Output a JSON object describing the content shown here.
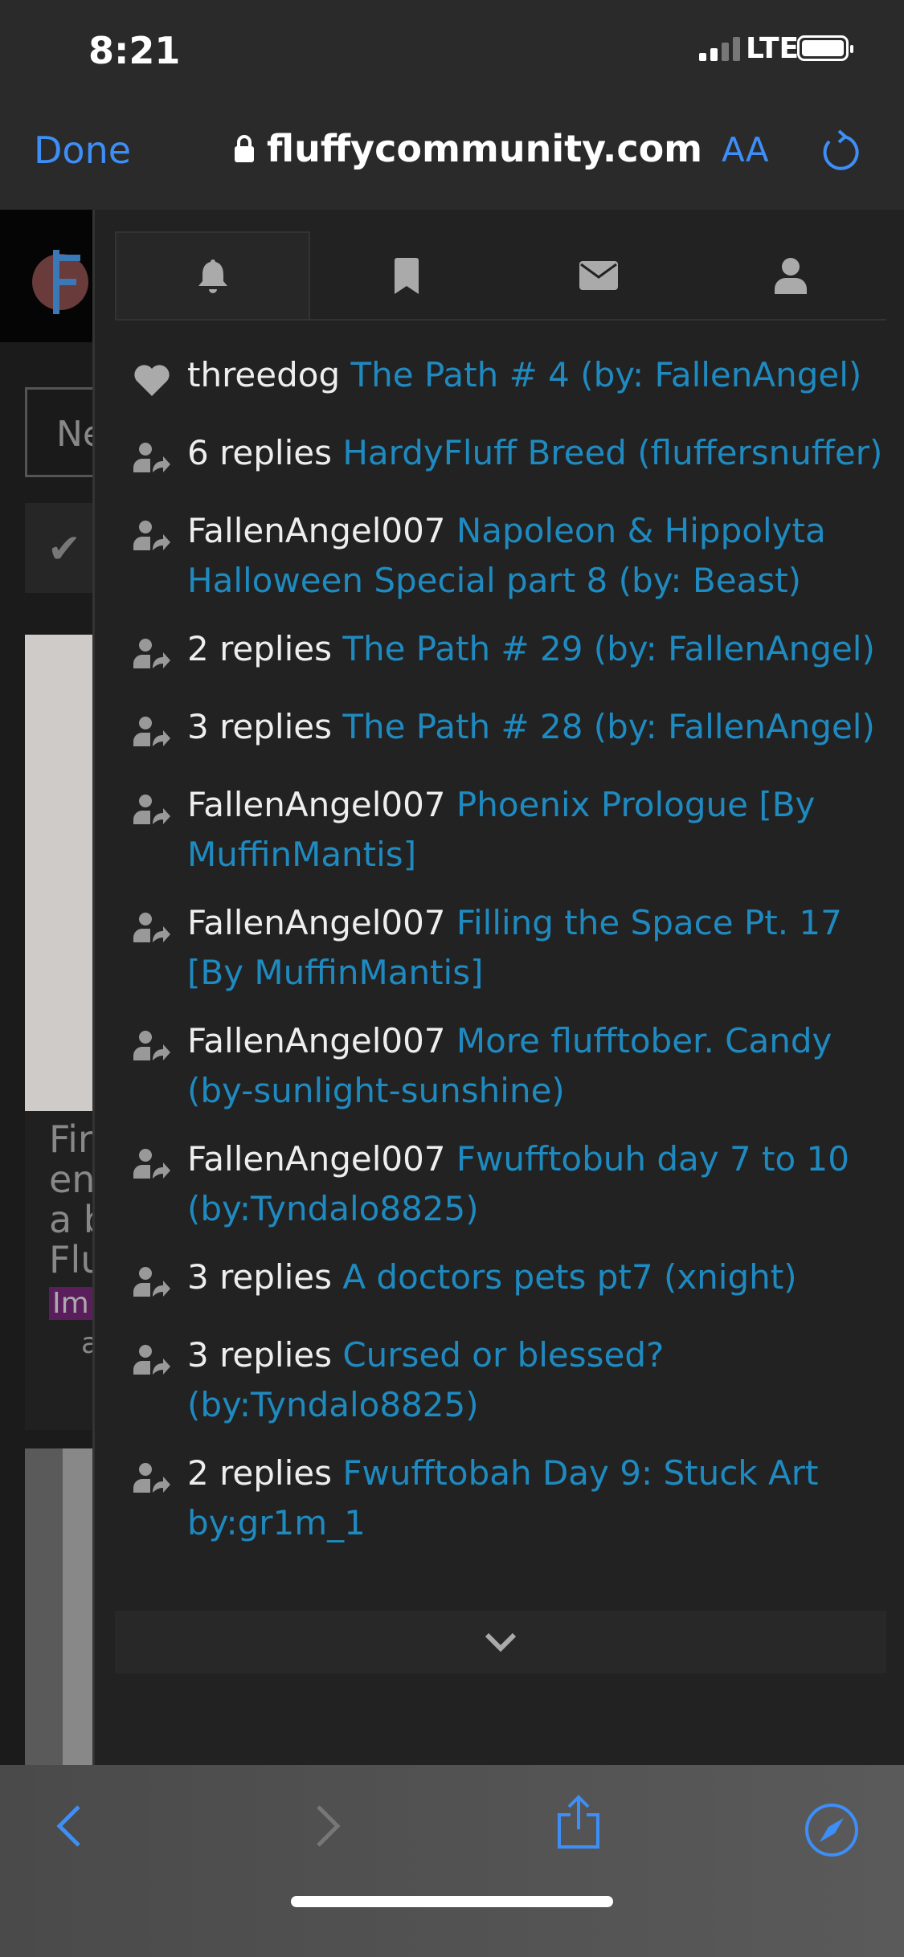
{
  "status_bar": {
    "time": "8:21",
    "network": "LTE"
  },
  "browser": {
    "done_label": "Done",
    "url": "fluffycommunity.com",
    "text_size_label": "AA"
  },
  "background_page": {
    "input_partial": "Ne",
    "card_text_lines": [
      "Fir",
      "en",
      "a b",
      "Flu"
    ],
    "tag_partial": "Im",
    "meta_partial": "ac"
  },
  "panel": {
    "tabs": [
      {
        "icon": "bell-icon",
        "active": true
      },
      {
        "icon": "bookmark-icon"
      },
      {
        "icon": "envelope-icon"
      },
      {
        "icon": "user-icon"
      }
    ],
    "notifications": [
      {
        "icon": "heart-icon",
        "actor": "threedog",
        "link": "The Path # 4 (by: FallenAngel)"
      },
      {
        "icon": "user-reply-icon",
        "actor": "6 replies",
        "link": "HardyFluff Breed (fluffersnuffer)"
      },
      {
        "icon": "user-reply-icon",
        "actor": "FallenAngel007",
        "link": "Napoleon & Hippolyta Halloween Special part 8 (by: Beast)"
      },
      {
        "icon": "user-reply-icon",
        "actor": "2 replies",
        "link": "The Path # 29 (by: FallenAngel)"
      },
      {
        "icon": "user-reply-icon",
        "actor": "3 replies",
        "link": "The Path # 28 (by: FallenAngel)"
      },
      {
        "icon": "user-reply-icon",
        "actor": "FallenAngel007",
        "link": "Phoenix Prologue [By MuffinMantis]"
      },
      {
        "icon": "user-reply-icon",
        "actor": "FallenAngel007",
        "link": "Filling the Space Pt. 17 [By MuffinMantis]"
      },
      {
        "icon": "user-reply-icon",
        "actor": "FallenAngel007",
        "link": "More flufftober. Candy (by-sunlight-sunshine)"
      },
      {
        "icon": "user-reply-icon",
        "actor": "FallenAngel007",
        "link": "Fwufftobuh day 7 to 10 (by:Tyndalo8825)"
      },
      {
        "icon": "user-reply-icon",
        "actor": "3 replies",
        "link": "A doctors pets pt7 (xnight)"
      },
      {
        "icon": "user-reply-icon",
        "actor": "3 replies",
        "link": "Cursed or blessed? (by:Tyndalo8825)"
      },
      {
        "icon": "user-reply-icon",
        "actor": "2 replies",
        "link": "Fwufftobah Day 9: Stuck Art by:gr1m_1"
      }
    ]
  },
  "colors": {
    "accent": "#3e8ef7",
    "link": "#1f8ac0",
    "panel": "#222222"
  }
}
